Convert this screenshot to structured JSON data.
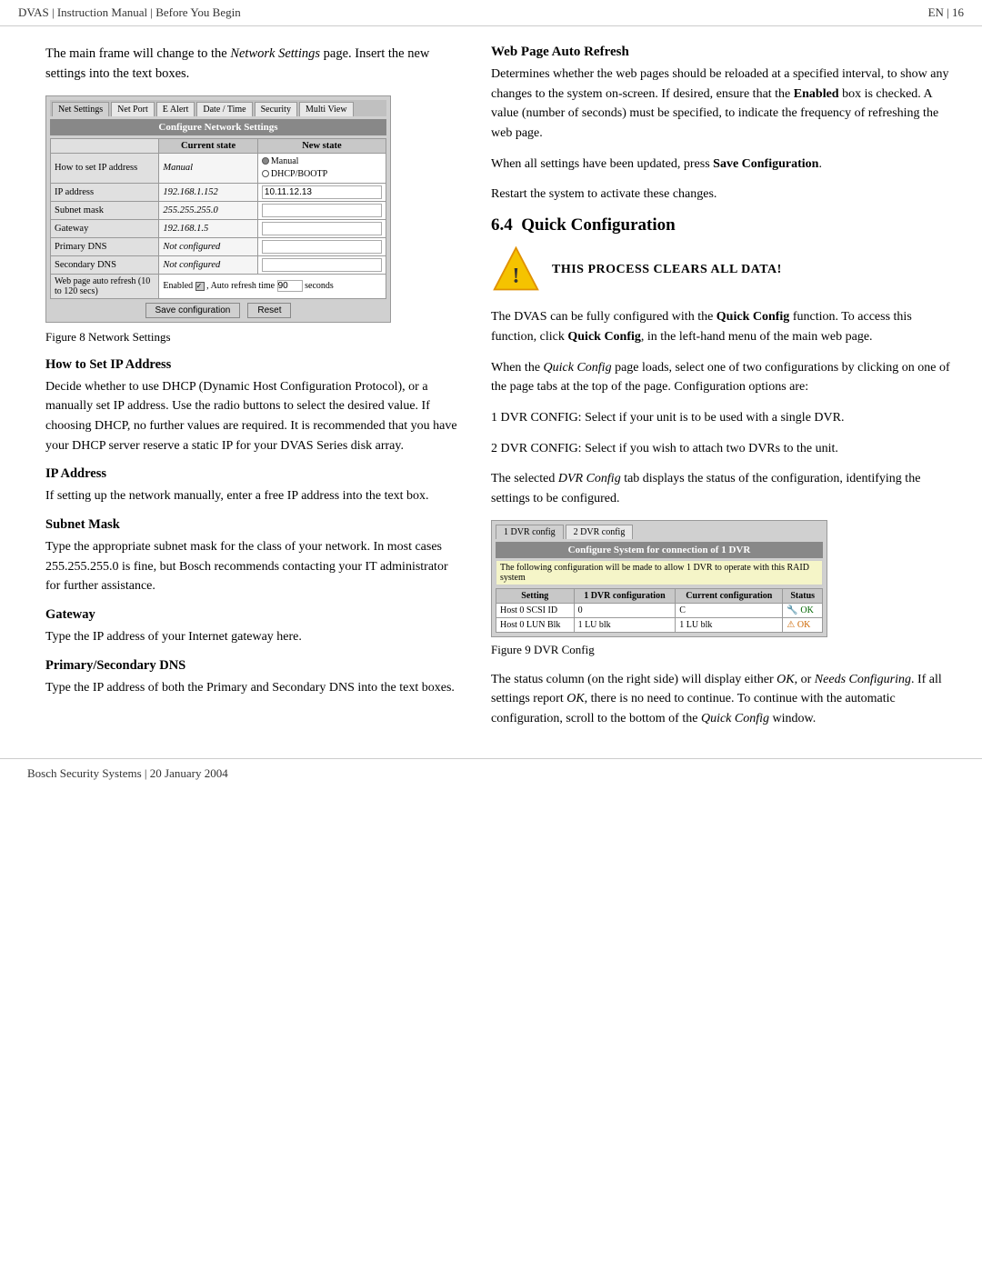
{
  "header": {
    "left": "DVAS | Instruction Manual | Before You Begin",
    "right": "EN | 16"
  },
  "intro": {
    "para1a": "The main frame will change to the ",
    "para1_italic": "Network Settings",
    "para1b": " page. Insert the new settings into the text boxes."
  },
  "network_screenshot": {
    "title": "Configure Network Settings",
    "tabs": [
      "Net Settings",
      "Net Port",
      "E Alert",
      "Date / Time",
      "Security",
      "Multi View"
    ],
    "col_current": "Current state",
    "col_new": "New state",
    "rows": [
      {
        "label": "How to set IP address",
        "current": "Manual",
        "new_radio": true
      },
      {
        "label": "IP address",
        "current": "192.168.1.152",
        "new_val": "10.11.12.13"
      },
      {
        "label": "Subnet mask",
        "current": "255.255.255.0",
        "new_val": ""
      },
      {
        "label": "Gateway",
        "current": "192.168.1.5",
        "new_val": ""
      },
      {
        "label": "Primary DNS",
        "current": "Not configured",
        "new_val": ""
      },
      {
        "label": "Secondary DNS",
        "current": "Not configured",
        "new_val": ""
      },
      {
        "label": "Web page auto refresh (10 to 120 secs)",
        "current": "Enabled ✓ , Auto refresh time 90  seconds",
        "new_val": null
      }
    ],
    "btn_save": "Save configuration",
    "btn_reset": "Reset"
  },
  "fig8_caption": "Figure 8   Network Settings",
  "sections": [
    {
      "heading": "How to Set IP Address",
      "body": "Decide whether to use DHCP (Dynamic Host Configuration Protocol), or a manually set IP address. Use the radio buttons to select the desired value. If choosing DHCP, no further values are required. It is recommended that you have your DHCP server reserve a static IP for your DVAS Series disk array."
    },
    {
      "heading": "IP Address",
      "body": "If setting up the network manually, enter a free IP address into the text box."
    },
    {
      "heading": "Subnet Mask",
      "body": "Type the appropriate subnet mask for the class of your network. In most cases 255.255.255.0 is fine, but Bosch recommends contacting your IT administrator for further assistance."
    },
    {
      "heading": "Gateway",
      "body": "Type the IP address of your Internet gateway here."
    },
    {
      "heading": "Primary/Secondary DNS",
      "body": "Type the IP address of both the Primary and Secondary DNS into the text boxes."
    }
  ],
  "right_sections": [
    {
      "heading": "Web Page Auto Refresh",
      "body": "Determines whether the web pages should be reloaded at a specified interval, to show any changes to the system on-screen. If desired, ensure that the Enabled box is checked. A value (number of seconds) must be specified, to indicate the frequency of refreshing the web page."
    }
  ],
  "save_config_para": "When all settings have been updated, press Save Configuration.",
  "restart_para": "Restart the system to activate these changes.",
  "quick_config": {
    "section_num": "6.4",
    "heading": "Quick Configuration",
    "warning_text": "THIS PROCESS CLEARS ALL DATA!",
    "paras": [
      "The DVAS can be fully configured with the Quick Config function. To access this function, click Quick Config, in the left-hand menu of the main web page.",
      "When the Quick Config page loads, select one of two configurations by clicking on one of the page tabs at the top of the page. Configuration options are:",
      "1 DVR CONFIG: Select if your unit is to be used with a single DVR.",
      "2 DVR CONFIG: Select if you wish to attach two DVRs to the unit.",
      "The selected DVR Config tab displays the status of the configuration, identifying the settings to be configured."
    ]
  },
  "dvr_screenshot": {
    "tabs": [
      "1 DVR config",
      "2 DVR config"
    ],
    "title": "Configure System for connection of 1 DVR",
    "notice": "The following configuration will be made to allow 1 DVR to operate with this RAID system",
    "col_setting": "Setting",
    "col_1dvr": "1 DVR configuration",
    "col_current": "Current configuration",
    "col_status": "Status",
    "rows": [
      {
        "setting": "Host 0 SCSI ID",
        "dvr_val": "0",
        "current_val": "C",
        "status": "OK",
        "status_type": "ok"
      },
      {
        "setting": "Host 0 LUN Blk",
        "dvr_val": "1 LU blk",
        "current_val": "1 LU blk",
        "status": "OK",
        "status_type": "warn"
      }
    ]
  },
  "fig9_caption": "Figure 9   DVR Config",
  "dvr_paras": [
    "The status column (on the right side) will display either OK, or Needs Configuring. If all settings report OK, there is no need to continue. To continue with the automatic configuration, scroll to the bottom of the Quick Config window."
  ],
  "footer": {
    "text": "Bosch Security Systems | 20 January 2004"
  }
}
